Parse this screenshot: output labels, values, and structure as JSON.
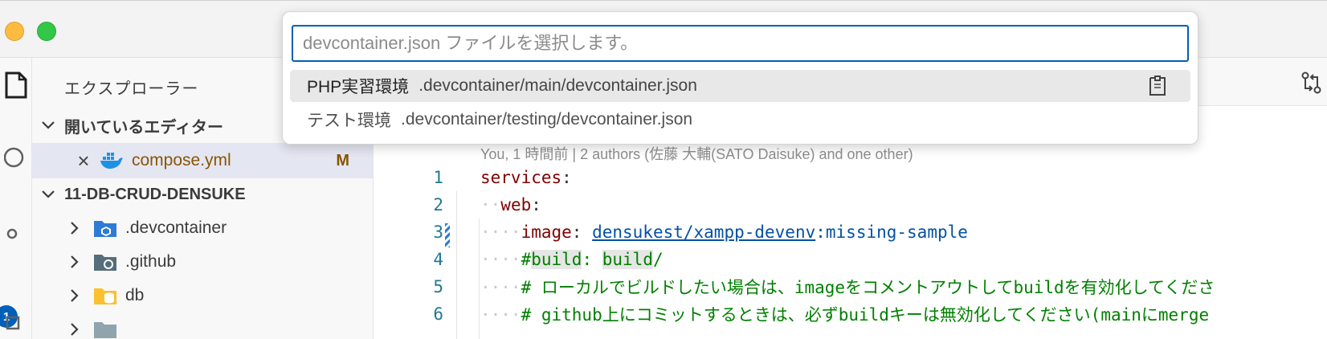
{
  "quick_pick": {
    "placeholder": "devcontainer.json ファイルを選択します。",
    "items": [
      {
        "label": "PHP実習環境",
        "description": ".devcontainer/main/devcontainer.json",
        "icon": "open-file-icon"
      },
      {
        "label": "テスト環境",
        "description": ".devcontainer/testing/devcontainer.json"
      }
    ]
  },
  "sidebar": {
    "title": "エクスプローラー",
    "open_editors": {
      "header": "開いているエディター",
      "items": [
        {
          "name": "compose.yml",
          "status": "M",
          "icon": "docker-icon"
        }
      ]
    },
    "folder": {
      "name": "11-DB-CRUD-DENSUKE",
      "items": [
        {
          "name": ".devcontainer",
          "icon": "folder-devcontainer-icon"
        },
        {
          "name": ".github",
          "icon": "folder-github-icon"
        },
        {
          "name": "db",
          "icon": "folder-db-icon"
        }
      ]
    }
  },
  "activity_bar": {
    "badge": "1"
  },
  "editor": {
    "blame": "You, 1 時間前 | 2 authors (佐藤 大輔(SATO Daisuke) and one other)",
    "lines": [
      {
        "number": "1",
        "key": "services",
        "colon": ":"
      },
      {
        "number": "2",
        "key": "web",
        "colon": ":"
      },
      {
        "number": "3",
        "key": "image",
        "colon": ": ",
        "value_link": "densukest/xampp-devenv",
        "value_rest": ":missing-sample"
      },
      {
        "number": "4",
        "comment_a": "#",
        "comment_b": "build",
        "comment_c": ": ",
        "comment_d": "build",
        "comment_e": "/"
      },
      {
        "number": "5",
        "comment": "# ローカルでビルドしたい場合は、imageをコメントアウトしてbuildを有効化してくださ"
      },
      {
        "number": "6",
        "comment": "# github上にコミットするときは、必ずbuildキーは無効化してください(mainにmerge"
      }
    ]
  },
  "colors": {
    "accent": "#005fb8",
    "modified": "#895503",
    "yaml_key": "#800000",
    "yaml_value": "#0451a5",
    "comment": "#008000"
  }
}
